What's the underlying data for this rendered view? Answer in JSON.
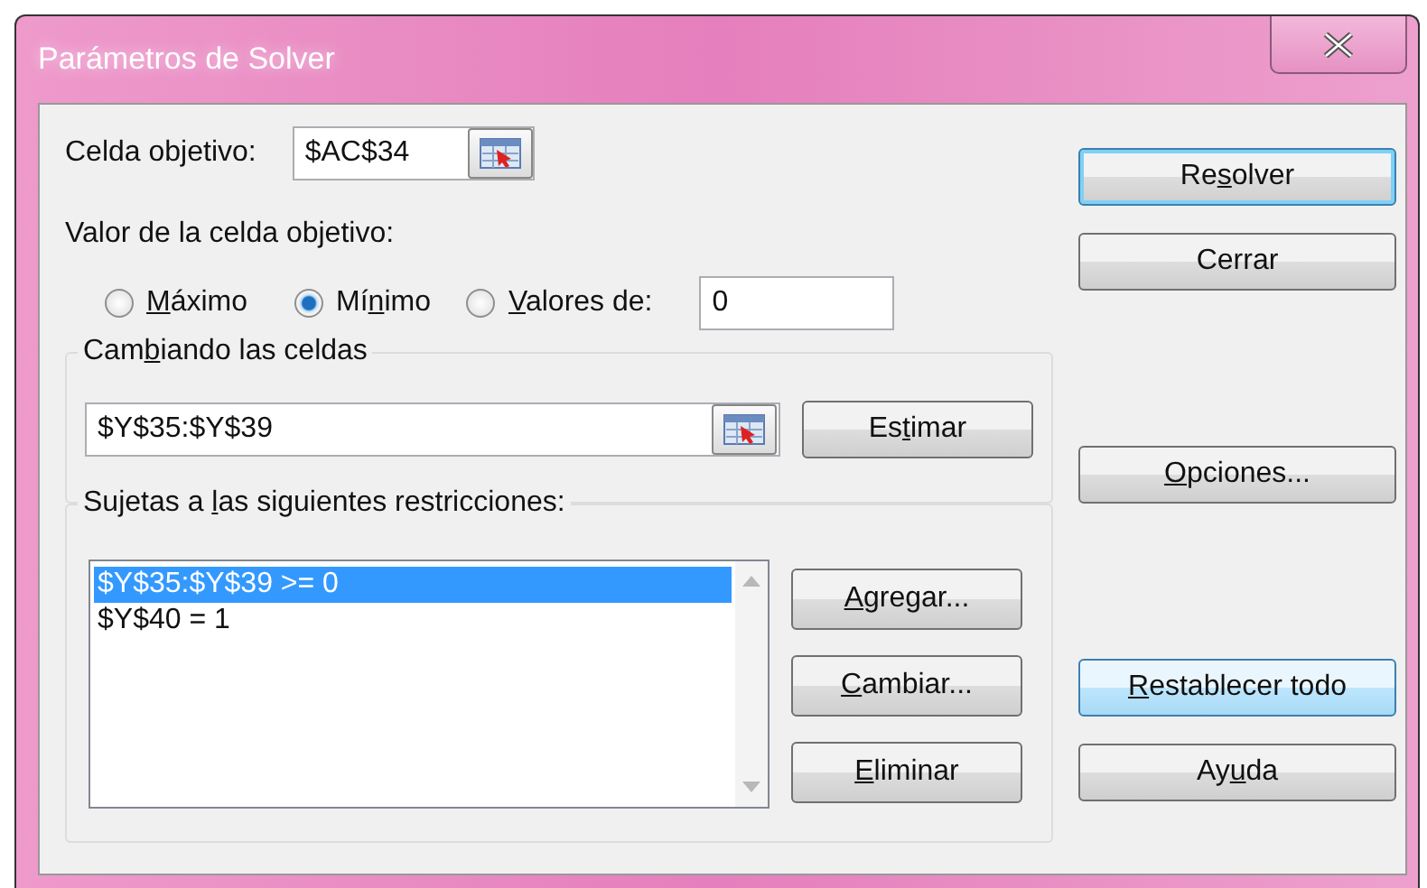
{
  "window": {
    "title": "Parámetros de Solver"
  },
  "target_cell": {
    "label": "Celda objetivo:",
    "value": "$AC$34"
  },
  "objective": {
    "label": "Valor de la celda objetivo:",
    "options": [
      {
        "label": {
          "key": "M",
          "post": "áximo"
        },
        "selected": false
      },
      {
        "label": {
          "pre": "Mí",
          "key": "n",
          "post": "imo"
        },
        "selected": true
      },
      {
        "label": {
          "key": "V",
          "post": "alores de:"
        },
        "selected": false
      }
    ],
    "value": "0"
  },
  "changing": {
    "legend": {
      "pre": "Cam",
      "key": "b",
      "post": "iando las celdas"
    },
    "value": "$Y$35:$Y$39",
    "button": {
      "pre": "Es",
      "key": "t",
      "post": "imar"
    }
  },
  "constraints": {
    "legend": {
      "pre": "Sujetas a ",
      "key": "l",
      "post": "as siguientes restricciones:"
    },
    "items": [
      {
        "text": "$Y$35:$Y$39 >= 0",
        "selected": true
      },
      {
        "text": "$Y$40 = 1",
        "selected": false
      }
    ],
    "buttons": [
      {
        "key": "A",
        "post": "gregar..."
      },
      {
        "key": "C",
        "post": "ambiar..."
      },
      {
        "key": "E",
        "post": "liminar"
      }
    ]
  },
  "side_buttons": [
    {
      "label": {
        "pre": "Re",
        "key": "s",
        "post": "olver"
      },
      "kind": "default"
    },
    {
      "label": {
        "post": "Cerrar"
      },
      "kind": "normal"
    },
    {
      "label": {
        "key": "O",
        "post": "pciones..."
      },
      "kind": "normal"
    },
    {
      "label": {
        "key": "R",
        "post": "establecer todo"
      },
      "kind": "hot"
    },
    {
      "label": {
        "pre": "Ay",
        "key": "u",
        "post": "da"
      },
      "kind": "normal"
    }
  ]
}
